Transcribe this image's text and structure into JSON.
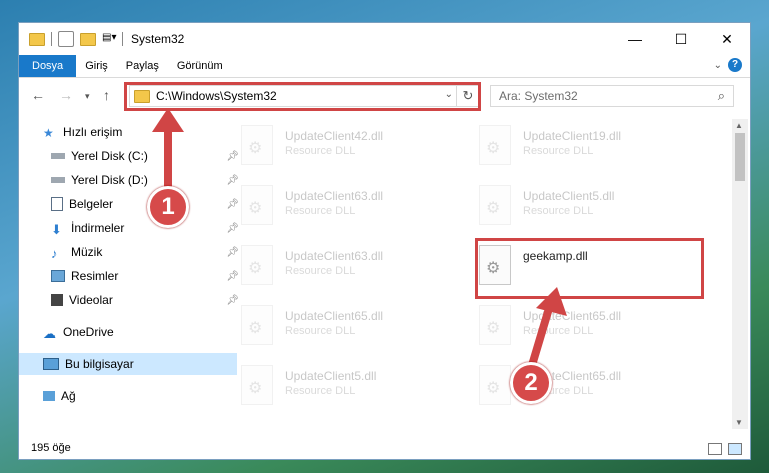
{
  "window": {
    "title": "System32",
    "controls": {
      "minimize": "—",
      "maximize": "☐",
      "close": "✕"
    }
  },
  "ribbon": {
    "tabs": [
      {
        "label": "Dosya",
        "active": true
      },
      {
        "label": "Giriş"
      },
      {
        "label": "Paylaş"
      },
      {
        "label": "Görünüm"
      }
    ],
    "help": "?"
  },
  "navbar": {
    "address": "C:\\Windows\\System32",
    "search_placeholder": "Ara: System32"
  },
  "sidebar": {
    "items": [
      {
        "label": "Hızlı erişim",
        "icon": "star-icon"
      },
      {
        "label": "Yerel Disk (C:)",
        "icon": "drive-icon",
        "pinned": true
      },
      {
        "label": "Yerel Disk (D:)",
        "icon": "drive-icon",
        "pinned": true
      },
      {
        "label": "Belgeler",
        "icon": "documents-icon",
        "pinned": true
      },
      {
        "label": "İndirmeler",
        "icon": "downloads-icon",
        "pinned": true
      },
      {
        "label": "Müzik",
        "icon": "music-icon",
        "pinned": true
      },
      {
        "label": "Resimler",
        "icon": "pictures-icon",
        "pinned": true
      },
      {
        "label": "Videolar",
        "icon": "videos-icon",
        "pinned": true
      },
      {
        "label": "OneDrive",
        "icon": "onedrive-icon"
      },
      {
        "label": "Bu bilgisayar",
        "icon": "computer-icon",
        "selected": true
      },
      {
        "label": "Ağ",
        "icon": "network-icon"
      }
    ]
  },
  "files": [
    {
      "name": "UpdateClient42.dll",
      "type": "Resource DLL"
    },
    {
      "name": "UpdateClient19.dll",
      "type": "Resource DLL"
    },
    {
      "name": "UpdateClient63.dll",
      "type": "Resource DLL"
    },
    {
      "name": "UpdateClient5.dll",
      "type": "Resource DLL"
    },
    {
      "name": "UpdateClient63.dll",
      "type": "Resource DLL"
    },
    {
      "name": "geekamp.dll",
      "type": ""
    },
    {
      "name": "UpdateClient65.dll",
      "type": "Resource DLL"
    },
    {
      "name": "UpdateClient65.dll",
      "type": "Resource DLL"
    },
    {
      "name": "UpdateClient5.dll",
      "type": "Resource DLL"
    },
    {
      "name": "UpdateClient65.dll",
      "type": "Resource DLL"
    }
  ],
  "status": {
    "item_count": "195 öğe"
  },
  "annotations": {
    "badge1": "1",
    "badge2": "2",
    "color": "#d04545"
  }
}
